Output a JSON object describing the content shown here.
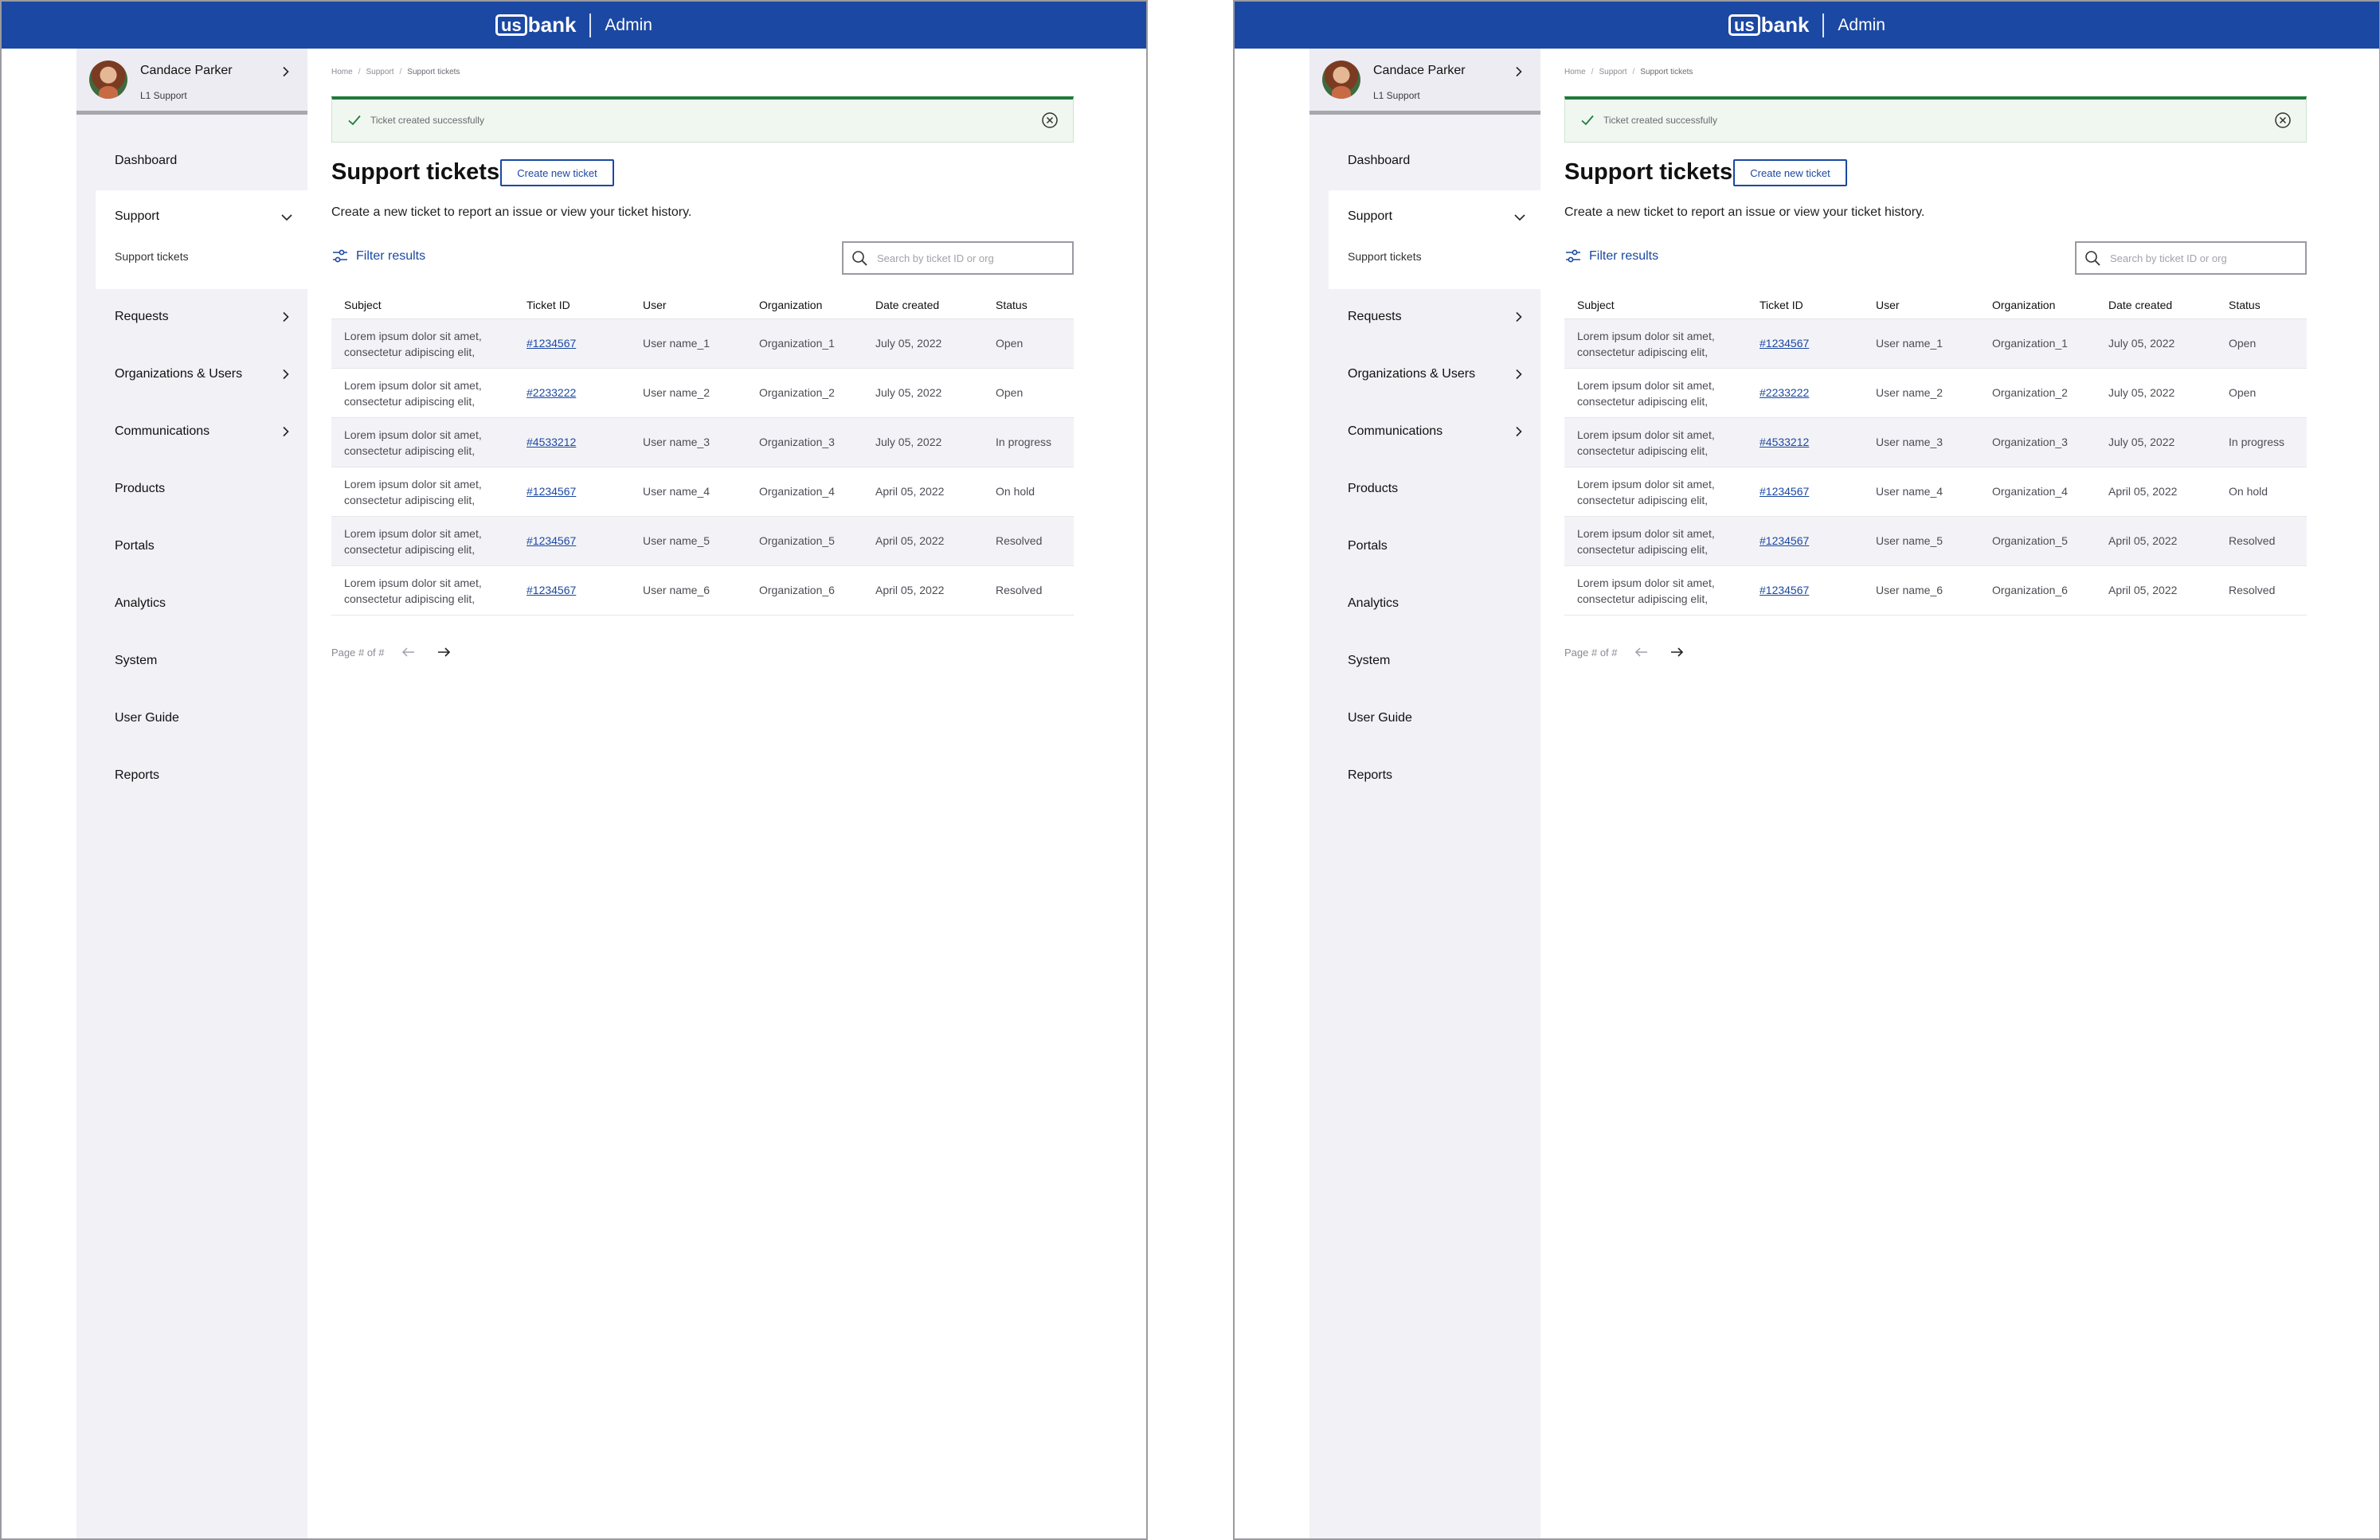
{
  "header": {
    "brand_us": "us",
    "brand_bank": "bank",
    "app_name": "Admin"
  },
  "profile": {
    "name": "Candace Parker",
    "role": "L1 Support"
  },
  "nav": {
    "dashboard": "Dashboard",
    "support": "Support",
    "support_tickets": "Support tickets",
    "requests": "Requests",
    "organizations_users": "Organizations & Users",
    "communications": "Communications",
    "products": "Products",
    "portals": "Portals",
    "analytics": "Analytics",
    "system": "System",
    "user_guide": "User Guide",
    "reports": "Reports"
  },
  "breadcrumb": {
    "home": "Home",
    "support": "Support",
    "current": "Support tickets",
    "separator": "/"
  },
  "alert": {
    "message": "Ticket created successfully"
  },
  "page": {
    "title": "Support tickets",
    "create_button": "Create new ticket",
    "description": "Create a new ticket to report an issue or view your ticket history."
  },
  "filter": {
    "label": "Filter results"
  },
  "search": {
    "placeholder": "Search by ticket ID or org"
  },
  "table": {
    "columns": {
      "subject": "Subject",
      "ticket_id": "Ticket ID",
      "user": "User",
      "organization": "Organization",
      "date_created": "Date created",
      "status": "Status"
    },
    "rows": [
      {
        "subject_line1": "Lorem ipsum dolor sit amet,",
        "subject_line2": "consectetur adipiscing elit,",
        "ticket_id": "#1234567",
        "user": "User name_1",
        "organization": "Organization_1",
        "date_created": "July 05, 2022",
        "status": "Open"
      },
      {
        "subject_line1": "Lorem ipsum dolor sit amet,",
        "subject_line2": "consectetur adipiscing elit,",
        "ticket_id": "#2233222",
        "user": "User name_2",
        "organization": "Organization_2",
        "date_created": "July 05, 2022",
        "status": "Open"
      },
      {
        "subject_line1": "Lorem ipsum dolor sit amet,",
        "subject_line2": "consectetur adipiscing elit,",
        "ticket_id": "#4533212",
        "user": "User name_3",
        "organization": "Organization_3",
        "date_created": "July 05, 2022",
        "status": "In progress"
      },
      {
        "subject_line1": "Lorem ipsum dolor sit amet,",
        "subject_line2": "consectetur adipiscing elit,",
        "ticket_id": "#1234567",
        "user": "User name_4",
        "organization": "Organization_4",
        "date_created": "April 05, 2022",
        "status": "On hold"
      },
      {
        "subject_line1": "Lorem ipsum dolor sit amet,",
        "subject_line2": "consectetur adipiscing elit,",
        "ticket_id": "#1234567",
        "user": "User name_5",
        "organization": "Organization_5",
        "date_created": "April 05, 2022",
        "status": "Resolved"
      },
      {
        "subject_line1": "Lorem ipsum dolor sit amet,",
        "subject_line2": "consectetur adipiscing elit,",
        "ticket_id": "#1234567",
        "user": "User name_6",
        "organization": "Organization_6",
        "date_created": "April 05, 2022",
        "status": "Resolved"
      }
    ]
  },
  "pagination": {
    "label": "Page # of #"
  },
  "icons": {
    "chevron_right": "chevron-right-icon",
    "chevron_down": "chevron-down-icon",
    "check": "check-icon",
    "close": "close-circle-icon",
    "filter": "sliders-icon",
    "search": "search-icon",
    "arrow_left": "arrow-left-icon",
    "arrow_right": "arrow-right-icon"
  },
  "colors": {
    "brand_blue": "#1b48a2",
    "success_green": "#1f7a3a",
    "sidebar_bg": "#f1f1f6",
    "row_stripe": "#f3f3f7"
  }
}
